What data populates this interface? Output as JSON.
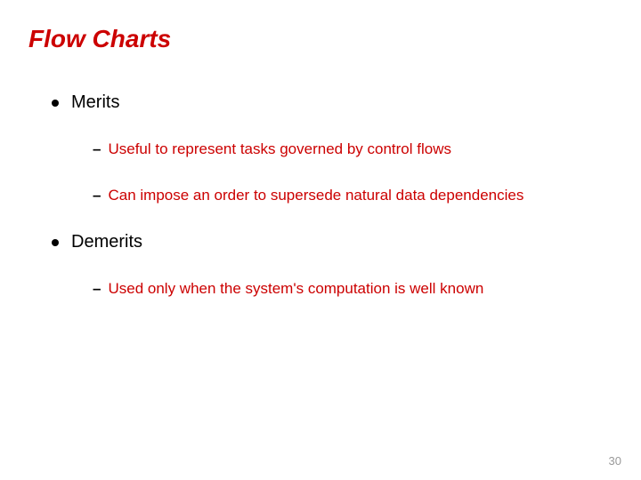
{
  "title": "Flow Charts",
  "sections": [
    {
      "heading": "Merits",
      "items": [
        "Useful to represent tasks governed by control flows",
        "Can impose an order to supersede natural data dependencies"
      ]
    },
    {
      "heading": "Demerits",
      "items": [
        "Used only when the system's computation is well known"
      ]
    }
  ],
  "page_number": "30"
}
